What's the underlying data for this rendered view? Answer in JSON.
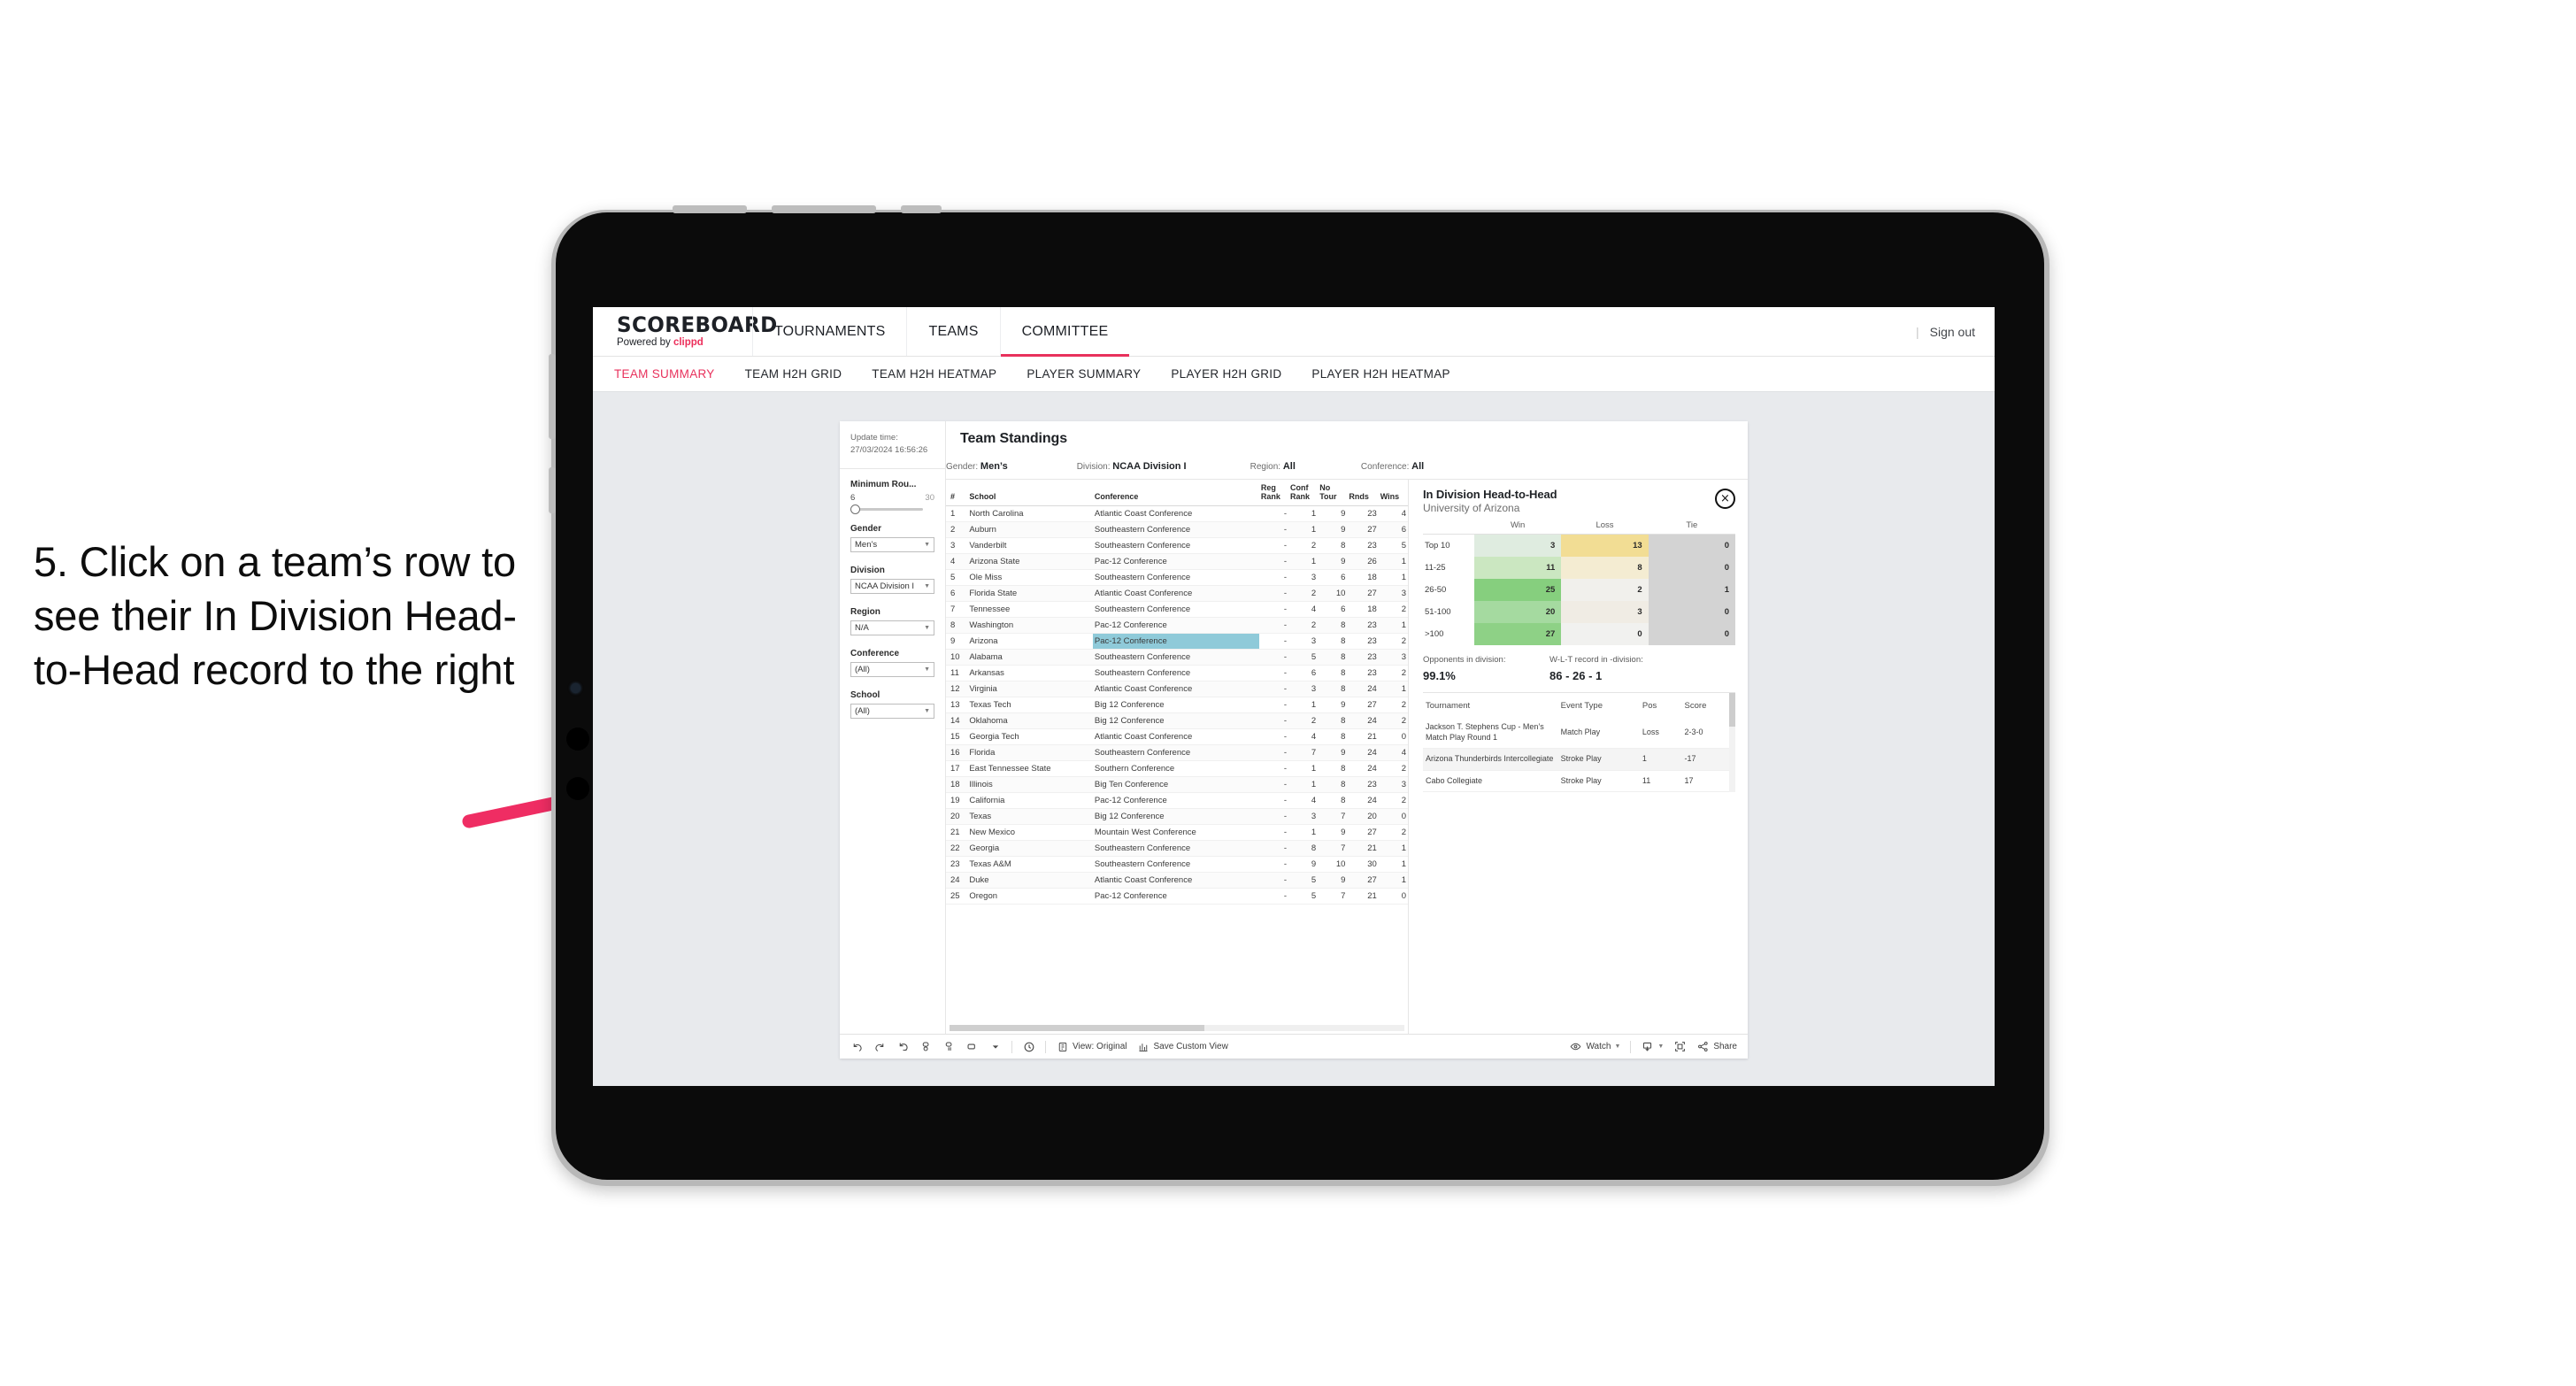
{
  "callout": {
    "text": "5. Click on a team’s row to see their In Division Head-to-Head record to the right"
  },
  "app": {
    "logo": "SCOREBOARD",
    "logo_sub_prefix": "Powered by",
    "logo_sub_brand": "clippd",
    "accent_color": "#e8315c",
    "nav": [
      {
        "label": "TOURNAMENTS",
        "active": false
      },
      {
        "label": "TEAMS",
        "active": false
      },
      {
        "label": "COMMITTEE",
        "active": true
      }
    ],
    "sign_out": "Sign out",
    "separator": "|",
    "subnav": [
      {
        "label": "TEAM SUMMARY",
        "active": true
      },
      {
        "label": "TEAM H2H GRID",
        "active": false
      },
      {
        "label": "TEAM H2H HEATMAP",
        "active": false
      },
      {
        "label": "PLAYER SUMMARY",
        "active": false
      },
      {
        "label": "PLAYER H2H GRID",
        "active": false
      },
      {
        "label": "PLAYER H2H HEATMAP",
        "active": false
      }
    ]
  },
  "filters": {
    "update_time_label": "Update time:",
    "update_time_value": "27/03/2024 16:56:26",
    "min_rounds": {
      "label": "Minimum Rou...",
      "min": "6",
      "max": "30"
    },
    "gender": {
      "label": "Gender",
      "value": "Men’s"
    },
    "division": {
      "label": "Division",
      "value": "NCAA Division I"
    },
    "region": {
      "label": "Region",
      "value": "N/A"
    },
    "conference": {
      "label": "Conference",
      "value": "(All)"
    },
    "school": {
      "label": "School",
      "value": "(All)"
    }
  },
  "standings": {
    "title": "Team Standings",
    "criteria": [
      {
        "label": "Gender:",
        "value": "Men’s"
      },
      {
        "label": "Division:",
        "value": "NCAA Division I"
      },
      {
        "label": "Region:",
        "value": "All"
      },
      {
        "label": "Conference:",
        "value": "All"
      }
    ],
    "columns": [
      "#",
      "School",
      "Conference",
      "Reg Rank",
      "Conf Rank",
      "No Tour",
      "Rnds",
      "Wins"
    ],
    "columns_wrapped": [
      {
        "l1": "#",
        "l2": ""
      },
      {
        "l1": "School",
        "l2": ""
      },
      {
        "l1": "Conference",
        "l2": ""
      },
      {
        "l1": "Reg",
        "l2": "Rank"
      },
      {
        "l1": "Conf",
        "l2": "Rank"
      },
      {
        "l1": "No",
        "l2": "Tour"
      },
      {
        "l1": "Rnds",
        "l2": ""
      },
      {
        "l1": "Wins",
        "l2": ""
      }
    ],
    "selected_row_index": 8,
    "selected_highlight_color": "#8fcad9",
    "rows": [
      {
        "n": "1",
        "school": "North Carolina",
        "conf": "Atlantic Coast Conference",
        "reg": "-",
        "confrank": "1",
        "notour": "9",
        "rnds": "23",
        "wins": "4"
      },
      {
        "n": "2",
        "school": "Auburn",
        "conf": "Southeastern Conference",
        "reg": "-",
        "confrank": "1",
        "notour": "9",
        "rnds": "27",
        "wins": "6"
      },
      {
        "n": "3",
        "school": "Vanderbilt",
        "conf": "Southeastern Conference",
        "reg": "-",
        "confrank": "2",
        "notour": "8",
        "rnds": "23",
        "wins": "5"
      },
      {
        "n": "4",
        "school": "Arizona State",
        "conf": "Pac-12 Conference",
        "reg": "-",
        "confrank": "1",
        "notour": "9",
        "rnds": "26",
        "wins": "1"
      },
      {
        "n": "5",
        "school": "Ole Miss",
        "conf": "Southeastern Conference",
        "reg": "-",
        "confrank": "3",
        "notour": "6",
        "rnds": "18",
        "wins": "1"
      },
      {
        "n": "6",
        "school": "Florida State",
        "conf": "Atlantic Coast Conference",
        "reg": "-",
        "confrank": "2",
        "notour": "10",
        "rnds": "27",
        "wins": "3"
      },
      {
        "n": "7",
        "school": "Tennessee",
        "conf": "Southeastern Conference",
        "reg": "-",
        "confrank": "4",
        "notour": "6",
        "rnds": "18",
        "wins": "2"
      },
      {
        "n": "8",
        "school": "Washington",
        "conf": "Pac-12 Conference",
        "reg": "-",
        "confrank": "2",
        "notour": "8",
        "rnds": "23",
        "wins": "1"
      },
      {
        "n": "9",
        "school": "Arizona",
        "conf": "Pac-12 Conference",
        "reg": "-",
        "confrank": "3",
        "notour": "8",
        "rnds": "23",
        "wins": "2"
      },
      {
        "n": "10",
        "school": "Alabama",
        "conf": "Southeastern Conference",
        "reg": "-",
        "confrank": "5",
        "notour": "8",
        "rnds": "23",
        "wins": "3"
      },
      {
        "n": "11",
        "school": "Arkansas",
        "conf": "Southeastern Conference",
        "reg": "-",
        "confrank": "6",
        "notour": "8",
        "rnds": "23",
        "wins": "2"
      },
      {
        "n": "12",
        "school": "Virginia",
        "conf": "Atlantic Coast Conference",
        "reg": "-",
        "confrank": "3",
        "notour": "8",
        "rnds": "24",
        "wins": "1"
      },
      {
        "n": "13",
        "school": "Texas Tech",
        "conf": "Big 12 Conference",
        "reg": "-",
        "confrank": "1",
        "notour": "9",
        "rnds": "27",
        "wins": "2"
      },
      {
        "n": "14",
        "school": "Oklahoma",
        "conf": "Big 12 Conference",
        "reg": "-",
        "confrank": "2",
        "notour": "8",
        "rnds": "24",
        "wins": "2"
      },
      {
        "n": "15",
        "school": "Georgia Tech",
        "conf": "Atlantic Coast Conference",
        "reg": "-",
        "confrank": "4",
        "notour": "8",
        "rnds": "21",
        "wins": "0"
      },
      {
        "n": "16",
        "school": "Florida",
        "conf": "Southeastern Conference",
        "reg": "-",
        "confrank": "7",
        "notour": "9",
        "rnds": "24",
        "wins": "4"
      },
      {
        "n": "17",
        "school": "East Tennessee State",
        "conf": "Southern Conference",
        "reg": "-",
        "confrank": "1",
        "notour": "8",
        "rnds": "24",
        "wins": "2"
      },
      {
        "n": "18",
        "school": "Illinois",
        "conf": "Big Ten Conference",
        "reg": "-",
        "confrank": "1",
        "notour": "8",
        "rnds": "23",
        "wins": "3"
      },
      {
        "n": "19",
        "school": "California",
        "conf": "Pac-12 Conference",
        "reg": "-",
        "confrank": "4",
        "notour": "8",
        "rnds": "24",
        "wins": "2"
      },
      {
        "n": "20",
        "school": "Texas",
        "conf": "Big 12 Conference",
        "reg": "-",
        "confrank": "3",
        "notour": "7",
        "rnds": "20",
        "wins": "0"
      },
      {
        "n": "21",
        "school": "New Mexico",
        "conf": "Mountain West Conference",
        "reg": "-",
        "confrank": "1",
        "notour": "9",
        "rnds": "27",
        "wins": "2"
      },
      {
        "n": "22",
        "school": "Georgia",
        "conf": "Southeastern Conference",
        "reg": "-",
        "confrank": "8",
        "notour": "7",
        "rnds": "21",
        "wins": "1"
      },
      {
        "n": "23",
        "school": "Texas A&M",
        "conf": "Southeastern Conference",
        "reg": "-",
        "confrank": "9",
        "notour": "10",
        "rnds": "30",
        "wins": "1"
      },
      {
        "n": "24",
        "school": "Duke",
        "conf": "Atlantic Coast Conference",
        "reg": "-",
        "confrank": "5",
        "notour": "9",
        "rnds": "27",
        "wins": "1"
      },
      {
        "n": "25",
        "school": "Oregon",
        "conf": "Pac-12 Conference",
        "reg": "-",
        "confrank": "5",
        "notour": "7",
        "rnds": "21",
        "wins": "0"
      }
    ]
  },
  "h2h": {
    "title": "In Division Head-to-Head",
    "subtitle": "University of Arizona",
    "close_label": "×",
    "columns": [
      "",
      "Win",
      "Loss",
      "Tie"
    ],
    "rows": [
      {
        "label": "Top 10",
        "win": "3",
        "loss": "13",
        "tie": "0",
        "win_color": "#dfece0",
        "loss_color": "#f2dd94",
        "tie_color": "#d3d3d3"
      },
      {
        "label": "11-25",
        "win": "11",
        "loss": "8",
        "tie": "0",
        "win_color": "#cbe7c1",
        "loss_color": "#f4ecd2",
        "tie_color": "#d3d3d3"
      },
      {
        "label": "26-50",
        "win": "25",
        "loss": "2",
        "tie": "1",
        "win_color": "#86cf7e",
        "loss_color": "#f1f0ec",
        "tie_color": "#d3d3d3"
      },
      {
        "label": "51-100",
        "win": "20",
        "loss": "3",
        "tie": "0",
        "win_color": "#a5daa0",
        "loss_color": "#f0ece4",
        "tie_color": "#d3d3d3"
      },
      {
        "label": ">100",
        "win": "27",
        "loss": "0",
        "tie": "0",
        "win_color": "#8ed186",
        "loss_color": "#f1f1ef",
        "tie_color": "#d3d3d3"
      }
    ],
    "stats": [
      {
        "label": "Opponents in division:",
        "value": "99.1%"
      },
      {
        "label": "W-L-T record in -division:",
        "value": "86 - 26 - 1"
      }
    ],
    "tournaments": {
      "columns": [
        "Tournament",
        "Event Type",
        "Pos",
        "Score"
      ],
      "rows": [
        {
          "name": "Jackson T. Stephens Cup - Men’s Match Play Round 1",
          "type": "Match Play",
          "pos": "Loss",
          "score": "2-3-0"
        },
        {
          "name": "Arizona Thunderbirds Intercollegiate",
          "type": "Stroke Play",
          "pos": "1",
          "score": "-17"
        },
        {
          "name": "Cabo Collegiate",
          "type": "Stroke Play",
          "pos": "11",
          "score": "17"
        }
      ]
    }
  },
  "toolbar": {
    "view_label": "View: Original",
    "save_label": "Save Custom View",
    "watch_label": "Watch",
    "share_label": "Share"
  }
}
